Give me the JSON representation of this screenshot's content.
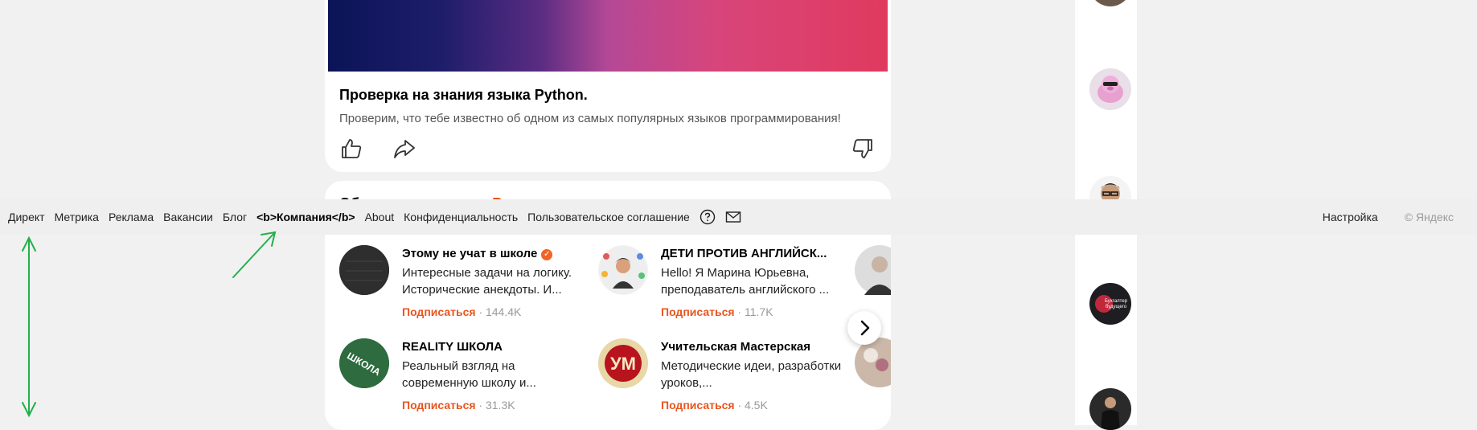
{
  "post": {
    "title": "Проверка на знания языка Python.",
    "description": "Проверим, что тебе известно об одном из самых популярных языков программирования!"
  },
  "subscriptions": {
    "title": "Об",
    "title_accent": "Вы",
    "channels": [
      {
        "name": "Этому не учат в школе",
        "desc": "Интересные задачи на логику. Исторические анекдоты. И...",
        "action": "Подписаться",
        "count": "· 144.4K",
        "verified": true
      },
      {
        "name": "ДЕТИ ПРОТИВ АНГЛИЙСК...",
        "desc": "Hello! Я Марина Юрьевна, преподаватель английского ...",
        "action": "Подписаться",
        "count": "· 11.7K",
        "verified": false
      },
      {
        "name": "REALITY ШКОЛА",
        "desc": "Реальный взгляд на современную школу и...",
        "action": "Подписаться",
        "count": "· 31.3K",
        "verified": false
      },
      {
        "name": "Учительская Мастерская",
        "desc": "Методические идеи, разработки уроков,...",
        "action": "Подписаться",
        "count": "· 4.5K",
        "verified": false
      }
    ],
    "avatar_ym_text": "УМ",
    "avatar_reality_text": "ШКОЛА"
  },
  "footer": {
    "links": [
      "Директ",
      "Метрика",
      "Реклама",
      "Вакансии",
      "Блог",
      "<b>Компания</b>",
      "About",
      "Конфиденциальность",
      "Пользовательское соглашение"
    ],
    "settings": "Настройка",
    "copyright": "© Яндекс"
  },
  "right_avatar_text": "Бухгалтер будущего",
  "colors": {
    "accent": "#e8551e",
    "annotation": "#22b04b",
    "background": "#f1f1f1"
  },
  "icons": [
    "like-icon",
    "share-icon",
    "dislike-icon",
    "help-icon",
    "mail-icon",
    "chevron-right-icon"
  ]
}
